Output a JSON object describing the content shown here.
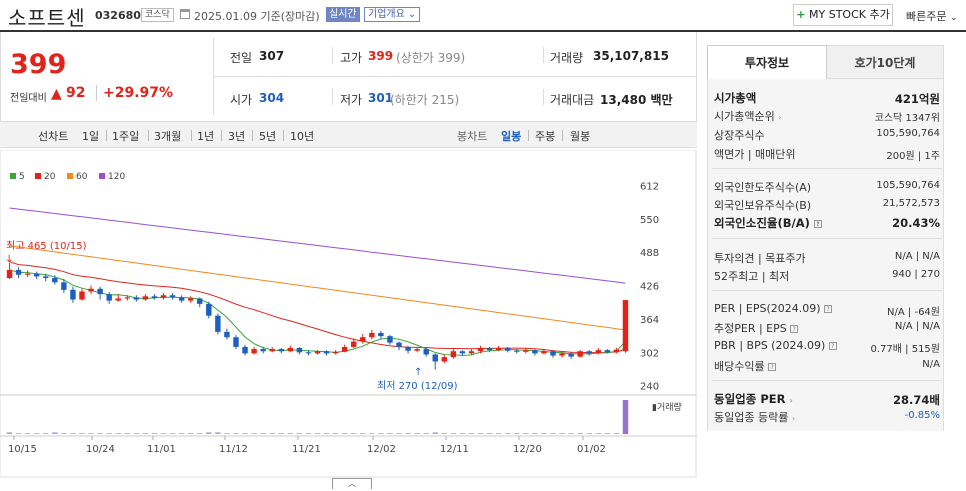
{
  "header": {
    "name": "소프트센",
    "code": "032680",
    "market": "코스닥",
    "date": "2025.01.09 기준(장마감)",
    "realtime": "실시간",
    "company_info": "기업개요",
    "my_stock": "MY STOCK 추가",
    "quick_order": "빠른주문"
  },
  "price": {
    "current": "399",
    "change_label": "전일대비",
    "change": "92",
    "change_pct": "+29.97%",
    "prev_label": "전일",
    "prev": "307",
    "open_label": "시가",
    "open": "304",
    "high_label": "고가",
    "high": "399",
    "high_note": "(상한가 399)",
    "low_label": "저가",
    "low": "301",
    "low_note": "(하한가 215)",
    "volume_label": "거래량",
    "volume": "35,107,815",
    "amount_label": "거래대금",
    "amount": "13,480 백만"
  },
  "periods": {
    "left": [
      "선차트",
      "1일",
      "1주일",
      "3개월",
      "1년",
      "3년",
      "5년",
      "10년"
    ],
    "right_label": "봉차트",
    "right": [
      "일봉",
      "주봉",
      "월봉"
    ]
  },
  "legend": [
    {
      "label": "5",
      "color": "#3aa53a"
    },
    {
      "label": "20",
      "color": "#e2231a"
    },
    {
      "label": "60",
      "color": "#f08a1d"
    },
    {
      "label": "120",
      "color": "#9b4fd0"
    }
  ],
  "chart_data": {
    "type": "candlestick",
    "x_ticks": [
      "10/15",
      "10/24",
      "11/01",
      "11/12",
      "11/21",
      "12/02",
      "12/11",
      "12/20",
      "01/02"
    ],
    "y_ticks": [
      612,
      550,
      488,
      426,
      364,
      302,
      240
    ],
    "ylim": [
      232,
      622
    ],
    "high_annotation": "최고 465 (10/15)",
    "low_annotation": "최저 270 (12/09)",
    "volume_label": "거래량",
    "candles": [
      [
        440,
        455,
        468,
        438
      ],
      [
        455,
        446,
        460,
        440
      ],
      [
        446,
        448,
        454,
        442
      ],
      [
        448,
        443,
        452,
        438
      ],
      [
        443,
        440,
        448,
        434
      ],
      [
        440,
        432,
        445,
        428
      ],
      [
        432,
        418,
        438,
        412
      ],
      [
        418,
        400,
        424,
        394
      ],
      [
        400,
        415,
        420,
        398
      ],
      [
        415,
        420,
        426,
        410
      ],
      [
        420,
        410,
        424,
        400
      ],
      [
        410,
        398,
        414,
        392
      ],
      [
        398,
        402,
        410,
        396
      ],
      [
        402,
        404,
        408,
        398
      ],
      [
        404,
        400,
        408,
        396
      ],
      [
        400,
        406,
        410,
        398
      ],
      [
        406,
        403,
        410,
        400
      ],
      [
        403,
        408,
        412,
        400
      ],
      [
        408,
        404,
        412,
        400
      ],
      [
        404,
        398,
        408,
        394
      ],
      [
        398,
        402,
        406,
        394
      ],
      [
        402,
        392,
        404,
        386
      ],
      [
        392,
        370,
        396,
        365
      ],
      [
        370,
        340,
        374,
        335
      ],
      [
        340,
        330,
        346,
        326
      ],
      [
        330,
        312,
        334,
        308
      ],
      [
        312,
        300,
        316,
        296
      ],
      [
        300,
        308,
        312,
        298
      ],
      [
        308,
        304,
        312,
        300
      ],
      [
        304,
        308,
        312,
        302
      ],
      [
        308,
        304,
        310,
        300
      ],
      [
        304,
        310,
        314,
        302
      ],
      [
        310,
        302,
        312,
        298
      ],
      [
        302,
        300,
        306,
        296
      ],
      [
        300,
        304,
        306,
        298
      ],
      [
        304,
        300,
        306,
        296
      ],
      [
        300,
        303,
        306,
        298
      ],
      [
        303,
        312,
        316,
        302
      ],
      [
        312,
        322,
        328,
        310
      ],
      [
        322,
        330,
        336,
        318
      ],
      [
        330,
        338,
        344,
        326
      ],
      [
        338,
        332,
        342,
        326
      ],
      [
        332,
        320,
        334,
        316
      ],
      [
        320,
        312,
        322,
        306
      ],
      [
        312,
        305,
        314,
        300
      ],
      [
        305,
        308,
        312,
        302
      ],
      [
        308,
        298,
        310,
        294
      ],
      [
        298,
        285,
        300,
        270
      ],
      [
        285,
        293,
        298,
        282
      ],
      [
        293,
        304,
        308,
        290
      ],
      [
        304,
        300,
        306,
        296
      ],
      [
        300,
        304,
        308,
        298
      ],
      [
        304,
        310,
        314,
        300
      ],
      [
        310,
        306,
        312,
        302
      ],
      [
        306,
        310,
        314,
        304
      ],
      [
        310,
        305,
        312,
        302
      ],
      [
        305,
        303,
        308,
        300
      ],
      [
        303,
        306,
        310,
        300
      ],
      [
        306,
        300,
        308,
        296
      ],
      [
        300,
        304,
        308,
        298
      ],
      [
        304,
        296,
        306,
        292
      ],
      [
        296,
        300,
        304,
        292
      ],
      [
        300,
        294,
        302,
        290
      ],
      [
        294,
        304,
        306,
        292
      ],
      [
        304,
        300,
        306,
        296
      ],
      [
        300,
        306,
        310,
        298
      ],
      [
        306,
        302,
        308,
        300
      ],
      [
        302,
        307,
        310,
        300
      ],
      [
        304,
        399,
        399,
        301
      ]
    ],
    "volumes": [
      2,
      1,
      1,
      1,
      1,
      2,
      1,
      1,
      1,
      1,
      1,
      1,
      1,
      1,
      1,
      1,
      1,
      1,
      1,
      1,
      1,
      1,
      2,
      2,
      1,
      1,
      1,
      1,
      1,
      1,
      1,
      1,
      1,
      1,
      1,
      1,
      1,
      1,
      1,
      1,
      1,
      1,
      1,
      1,
      1,
      1,
      1,
      2,
      1,
      1,
      1,
      1,
      1,
      1,
      1,
      1,
      1,
      1,
      1,
      1,
      1,
      1,
      1,
      1,
      1,
      1,
      1,
      1,
      40
    ]
  },
  "tabs": [
    "투자정보",
    "호가10단계"
  ],
  "investment": {
    "market_cap_label": "시가총액",
    "market_cap": "421억원",
    "cap_rank_label": "시가총액순위",
    "cap_rank": "코스닥 1347위",
    "shares_label": "상장주식수",
    "shares": "105,590,764",
    "par_label": "액면가 | 매매단위",
    "par": "200원 | 1주",
    "foreign_limit_label": "외국인한도주식수(A)",
    "foreign_limit": "105,590,764",
    "foreign_hold_label": "외국인보유주식수(B)",
    "foreign_hold": "21,572,573",
    "foreign_rate_label": "외국인소진율(B/A)",
    "foreign_rate": "20.43%",
    "opinion_label": "투자의견 | 목표주가",
    "opinion": "N/A | N/A",
    "week52_label": "52주최고 | 최저",
    "week52": "940 | 270",
    "per_label": "PER | EPS(2024.09)",
    "per": "N/A | -64원",
    "est_per_label": "추정PER | EPS",
    "est_per": "N/A | N/A",
    "pbr_label": "PBR | BPS (2024.09)",
    "pbr": "0.77배 | 515원",
    "dividend_label": "배당수익률",
    "dividend": "N/A",
    "sector_per_label": "동일업종 PER",
    "sector_per": "28.74배",
    "sector_chg_label": "동일업종 등락률",
    "sector_chg": "-0.85%"
  }
}
